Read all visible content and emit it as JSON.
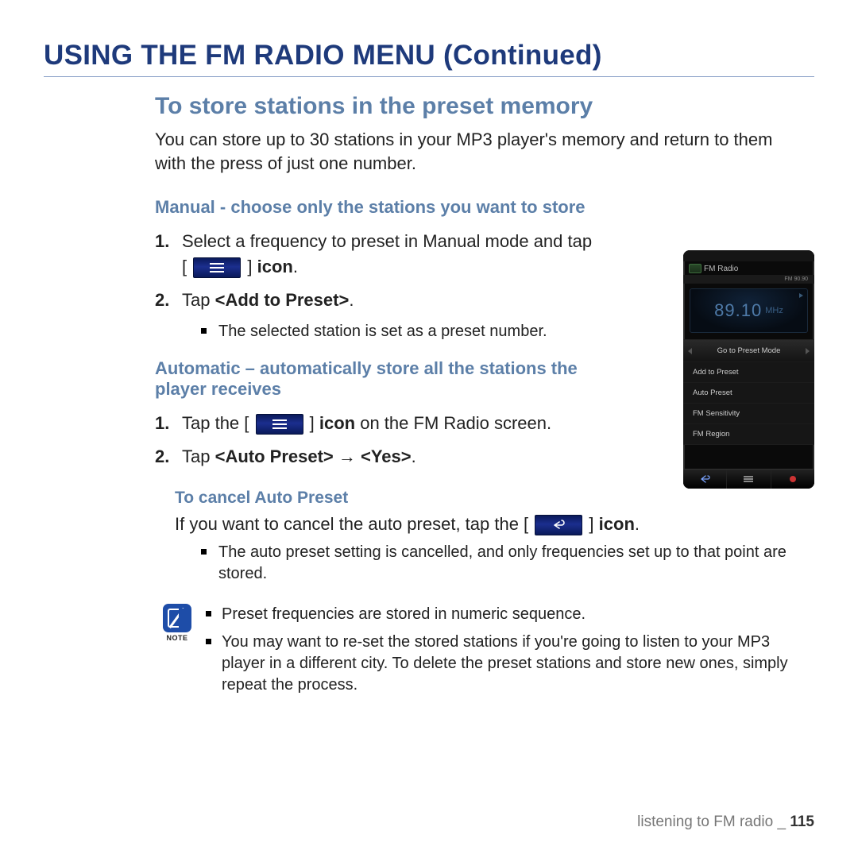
{
  "page": {
    "title": "USING THE FM RADIO MENU (Continued)",
    "footer_section": "listening to FM radio",
    "footer_separator": "_",
    "footer_page": "115"
  },
  "section": {
    "heading": "To store stations in the preset memory",
    "intro": "You can store up to 30 stations in your MP3 player's memory and return to them with the press of just one number."
  },
  "manual": {
    "heading": "Manual - choose only the stations you want to store",
    "step1_a": "Select a frequency to preset in Manual mode and tap [",
    "step1_b": "] ",
    "step1_c": "icon",
    "step1_d": ".",
    "step2_a": "Tap ",
    "step2_b": "<Add to Preset>",
    "step2_c": ".",
    "bullet": "The selected station is set as a preset number."
  },
  "auto": {
    "heading": "Automatic – automatically store all the stations the player receives",
    "step1_a": "Tap the [",
    "step1_b": "] ",
    "step1_c": "icon",
    "step1_d": " on the FM Radio screen.",
    "step2_a": "Tap ",
    "step2_b": "<Auto Preset> → <Yes>",
    "step2_c": "."
  },
  "cancel": {
    "heading": "To cancel Auto Preset",
    "para_a": "If you want to cancel the auto preset, tap the [",
    "para_b": "] ",
    "para_c": "icon",
    "para_d": ".",
    "bullet": "The auto preset setting is cancelled, and only frequencies set up to that point are stored."
  },
  "note": {
    "label": "NOTE",
    "b1": "Preset frequencies are stored in numeric sequence.",
    "b2": "You may want to re-set the stored stations if you're going to listen to your MP3 player in a different city. To delete the preset stations and store new ones, simply repeat the process."
  },
  "device": {
    "status_left": "",
    "status_right": "",
    "title": "FM Radio",
    "chip": "FM 90.90",
    "freq": "89.10",
    "unit": "MHz",
    "menu": {
      "m0": "Go to Preset Mode",
      "m1": "Add to Preset",
      "m2": "Auto Preset",
      "m3": "FM Sensitivity",
      "m4": "FM Region"
    }
  }
}
